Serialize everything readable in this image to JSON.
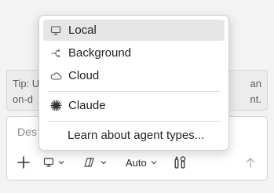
{
  "tip": {
    "left_text": "Tip: U\non-d",
    "right_text": "an\nnt."
  },
  "composer": {
    "placeholder_fragment": "Des",
    "mode_label": "Auto"
  },
  "menu": {
    "items": [
      {
        "label": "Local",
        "icon": "monitor-icon",
        "selected": true
      },
      {
        "label": "Background",
        "icon": "branch-icon",
        "selected": false
      },
      {
        "label": "Cloud",
        "icon": "cloud-icon",
        "selected": false
      },
      {
        "label": "Claude",
        "icon": "claude-asterisk-icon",
        "selected": false
      },
      {
        "label": "Learn about agent types...",
        "icon": "",
        "selected": false
      }
    ]
  }
}
